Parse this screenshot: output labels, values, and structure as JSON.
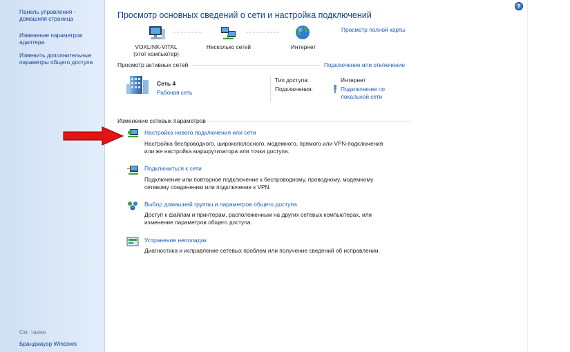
{
  "sidebar": {
    "home_link": "Панель управления - домашняя страница",
    "adapter_link": "Изменение параметров адаптера",
    "advanced_link": "Изменить дополнительные параметры общего доступа",
    "see_also": "См. также",
    "firewall_link": "Брандмауэр Windows"
  },
  "header": {
    "title": "Просмотр основных сведений о сети и настройка подключений",
    "full_map_link": "Просмотр полной карты"
  },
  "network_map": {
    "computer_name": "VOXLINK-VITAL",
    "computer_sub": "(этот компьютер)",
    "multiple_networks": "Несколько сетей",
    "internet": "Интернет"
  },
  "active_networks": {
    "heading": "Просмотр активных сетей",
    "connect_link": "Подключение или отключение",
    "network_name": "Сеть  4",
    "network_type": "Рабочая сеть",
    "access_type_label": "Тип доступа:",
    "access_type_value": "Интернет",
    "connections_label": "Подключения:",
    "connection_value": "Подключение по локальной сети"
  },
  "change_settings": {
    "heading": "Изменение сетевых параметров",
    "tasks": [
      {
        "title": "Настройка нового подключения или сети",
        "desc1": "Настройка беспроводного, широкополосного, модемного, прямого или VPN-подключения",
        "desc2": "или же настройка маршрутизатора или точки доступа."
      },
      {
        "title": "Подключиться к сети",
        "desc1": "Подключение или повторное подключение к беспроводному, проводному, модемному",
        "desc2": "сетевому соединению или подключение к VPN."
      },
      {
        "title": "Выбор домашней группы и параметров общего доступа",
        "desc1": "Доступ к файлам и принтерам, расположенным на других сетевых компьютерах, или",
        "desc2": "изменение параметров общего доступа."
      },
      {
        "title": "Устранение неполадок",
        "desc1": "Диагностика и исправление сетевых проблем или получение сведений об исправлении."
      }
    ]
  },
  "help_button": "?",
  "colors": {
    "link": "#1c5bb5",
    "sidebar_bg": "#dbe8f8",
    "arrow": "#e01010"
  }
}
